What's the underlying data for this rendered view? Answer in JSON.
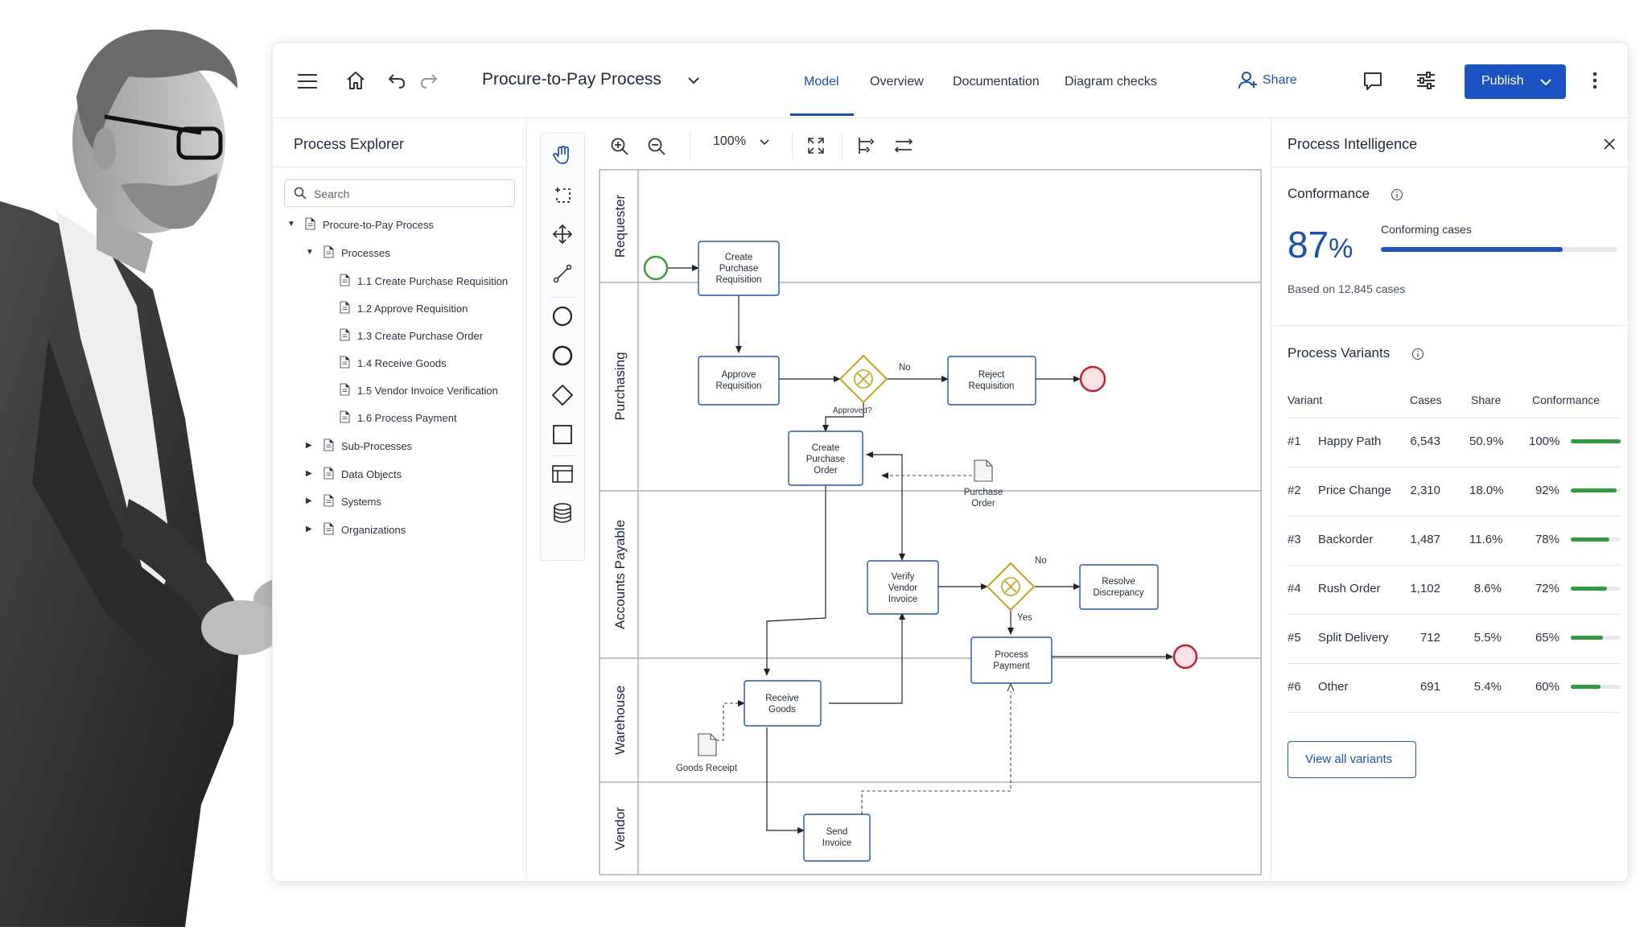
{
  "topbar": {
    "title": "Procure-to-Pay Process",
    "tabs": [
      {
        "label": "Model",
        "active": true
      },
      {
        "label": "Overview"
      },
      {
        "label": "Documentation"
      },
      {
        "label": "Diagram checks"
      }
    ],
    "share_label": "Share",
    "publish_label": "Publish"
  },
  "explorer": {
    "title": "Process Explorer",
    "search_placeholder": "Search",
    "tree": [
      {
        "label": "Procure-to-Pay Process",
        "level": 0,
        "expanded": true
      },
      {
        "label": "Processes",
        "level": 1,
        "expanded": true
      },
      {
        "label": "1.1 Create Purchase Requisition",
        "level": 2
      },
      {
        "label": "1.2 Approve Requisition",
        "level": 2
      },
      {
        "label": "1.3 Create Purchase Order",
        "level": 2
      },
      {
        "label": "1.4 Receive Goods",
        "level": 2
      },
      {
        "label": "1.5 Vendor Invoice Verification",
        "level": 2
      },
      {
        "label": "1.6 Process Payment",
        "level": 2
      },
      {
        "label": "Sub-Processes",
        "level": 1,
        "expanded": false
      },
      {
        "label": "Data Objects",
        "level": 1,
        "expanded": false
      },
      {
        "label": "Systems",
        "level": 1,
        "expanded": false
      },
      {
        "label": "Organizations",
        "level": 1,
        "expanded": false
      }
    ]
  },
  "canvas": {
    "zoom": "100%",
    "lanes": [
      "Requester",
      "Purchasing",
      "Accounts Payable",
      "Warehouse",
      "Vendor"
    ],
    "tasks": {
      "create_pr": [
        "Create",
        "Purchase",
        "Requisition"
      ],
      "approve_req": [
        "Approve",
        "Requisition"
      ],
      "reject_req": [
        "Reject",
        "Requisition"
      ],
      "create_po": [
        "Create",
        "Purchase",
        "Order"
      ],
      "verify_invoice": [
        "Verify",
        "Vendor",
        "Invoice"
      ],
      "resolve_discrepancy": [
        "Resolve",
        "Discrepancy"
      ],
      "process_payment": [
        "Process",
        "Payment"
      ],
      "receive_goods": [
        "Receive",
        "Goods"
      ],
      "send_invoice": [
        "Send",
        "Invoice"
      ]
    },
    "data_objects": {
      "purchase_order": [
        "Purchase",
        "Order"
      ],
      "goods_receipt": "Goods Receipt"
    },
    "flow_labels": {
      "no1": "No",
      "approved": "Approved?",
      "no2": "No",
      "yes": "Yes"
    },
    "colors": {
      "task_border": "#1d52c4",
      "gateway": "#c9a415",
      "start": "#3a9e3a",
      "end": "#c8202f"
    }
  },
  "intel": {
    "title": "Process Intelligence",
    "conformance": {
      "heading": "Conformance",
      "value": "87",
      "unit": "%",
      "bar_label": "Conforming cases",
      "fraction": 0.77,
      "based_on": "Based on 12,845 cases"
    },
    "variants": {
      "heading": "Process Variants",
      "columns": [
        "Variant",
        "Cases",
        "Share",
        "Conformance"
      ],
      "rows": [
        {
          "id": "#1",
          "name": "Happy Path",
          "cases": "6,543",
          "share": "50.9%",
          "conf": "100%",
          "level": 1.0
        },
        {
          "id": "#2",
          "name": "Price Change",
          "cases": "2,310",
          "share": "18.0%",
          "conf": "92%",
          "level": 0.92
        },
        {
          "id": "#3",
          "name": "Backorder",
          "cases": "1,487",
          "share": "11.6%",
          "conf": "78%",
          "level": 0.78
        },
        {
          "id": "#4",
          "name": "Rush Order",
          "cases": "1,102",
          "share": "8.6%",
          "conf": "72%",
          "level": 0.72
        },
        {
          "id": "#5",
          "name": "Split Delivery",
          "cases": "712",
          "share": "5.5%",
          "conf": "65%",
          "level": 0.65
        },
        {
          "id": "#6",
          "name": "Other",
          "cases": "691",
          "share": "5.4%",
          "conf": "60%",
          "level": 0.6
        }
      ],
      "view_all_label": "View all variants"
    }
  }
}
